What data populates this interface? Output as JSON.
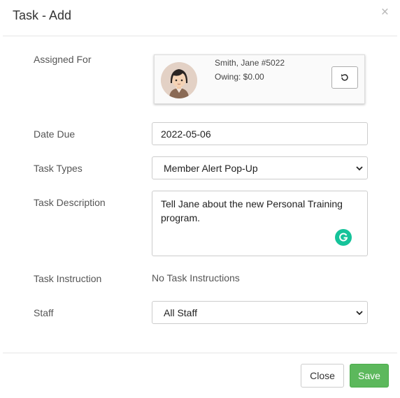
{
  "modal": {
    "title": "Task - Add",
    "close_symbol": "×"
  },
  "form": {
    "assigned_for": {
      "label": "Assigned For",
      "member_name": "Smith, Jane #5022",
      "owing": "Owing: $0.00",
      "refresh_icon": "refresh-icon",
      "avatar_icon": "female-avatar-icon"
    },
    "date_due": {
      "label": "Date Due",
      "value": "2022-05-06"
    },
    "task_types": {
      "label": "Task Types",
      "selected": "Member Alert Pop-Up"
    },
    "task_description": {
      "label": "Task Description",
      "value": "Tell Jane about the new Personal Training program.",
      "grammarly_icon": "grammarly-icon"
    },
    "task_instruction": {
      "label": "Task Instruction",
      "value": "No Task Instructions"
    },
    "staff": {
      "label": "Staff",
      "selected": "All Staff"
    }
  },
  "footer": {
    "close_label": "Close",
    "save_label": "Save"
  },
  "colors": {
    "save_green": "#5cb85c",
    "grammarly_green": "#15c39a"
  }
}
